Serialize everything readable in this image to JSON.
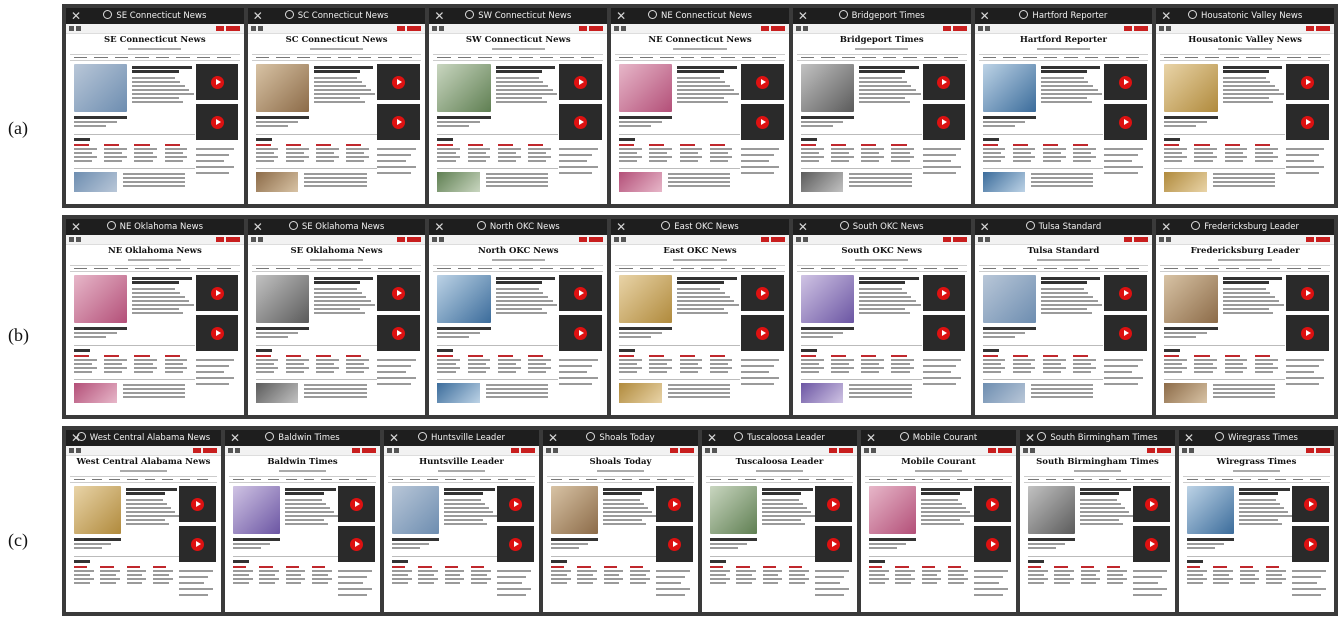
{
  "rows": [
    {
      "label": "(a)",
      "titles": [
        "SE Connecticut News",
        "SC Connecticut News",
        "SW Connecticut News",
        "NE Connecticut News",
        "Bridgeport Times",
        "Hartford Reporter",
        "Housatonic Valley News"
      ]
    },
    {
      "label": "(b)",
      "titles": [
        "NE Oklahoma News",
        "SE Oklahoma News",
        "North OKC News",
        "East OKC News",
        "South OKC News",
        "Tulsa Standard",
        "Fredericksburg Leader"
      ]
    },
    {
      "label": "(c)",
      "titles": [
        "West Central Alabama News",
        "Baldwin Times",
        "Huntsville Leader",
        "Shoals Today",
        "Tuscaloosa Leader",
        "Mobile Courant",
        "South Birmingham Times",
        "Wiregrass Times"
      ]
    }
  ],
  "icons": {
    "close": "close-icon",
    "site_logo": "site-logo-icon",
    "play": "play-icon"
  },
  "colors": {
    "titlebar": "#1e1e1e",
    "frame": "#3a3a3a",
    "accent_red": "#c81e1e"
  }
}
